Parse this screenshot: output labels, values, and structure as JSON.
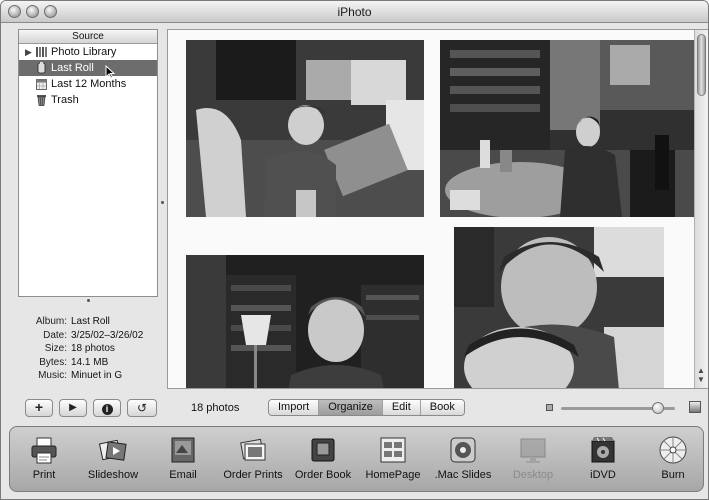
{
  "window": {
    "title": "iPhoto"
  },
  "source": {
    "header": "Source",
    "items": [
      {
        "label": "Photo Library",
        "icon": "library-icon",
        "disclosure": true
      },
      {
        "label": "Last Roll",
        "icon": "film-roll-icon",
        "selected": true
      },
      {
        "label": "Last 12 Months",
        "icon": "calendar-icon"
      },
      {
        "label": "Trash",
        "icon": "trash-icon"
      }
    ]
  },
  "info": {
    "album_label": "Album:",
    "album": "Last Roll",
    "date_label": "Date:",
    "date": "3/25/02–3/26/02",
    "size_label": "Size:",
    "size": "18 photos",
    "bytes_label": "Bytes:",
    "bytes": "14.1 MB",
    "music_label": "Music:",
    "music": "Minuet in G"
  },
  "controls": {
    "add_symbol": "+",
    "play_symbol": "▶",
    "info_symbol": "i",
    "rotate_symbol": "↺",
    "photo_count": "18 photos",
    "modes": [
      "Import",
      "Organize",
      "Edit",
      "Book"
    ],
    "active_mode": "Organize",
    "zoom_level": 0.85
  },
  "tools": [
    {
      "label": "Print",
      "icon": "printer-icon",
      "enabled": true
    },
    {
      "label": "Slideshow",
      "icon": "slideshow-icon",
      "enabled": true
    },
    {
      "label": "Email",
      "icon": "email-icon",
      "enabled": true
    },
    {
      "label": "Order Prints",
      "icon": "order-prints-icon",
      "enabled": true
    },
    {
      "label": "Order Book",
      "icon": "order-book-icon",
      "enabled": true
    },
    {
      "label": "HomePage",
      "icon": "homepage-icon",
      "enabled": true
    },
    {
      "label": ".Mac Slides",
      "icon": "mac-slides-icon",
      "enabled": true
    },
    {
      "label": "Desktop",
      "icon": "desktop-icon",
      "enabled": false
    },
    {
      "label": "iDVD",
      "icon": "idvd-icon",
      "enabled": true
    },
    {
      "label": "Burn",
      "icon": "burn-icon",
      "enabled": true
    }
  ],
  "colors": {
    "selection": "#6d6d6d",
    "toolbar": "#bdbdbd"
  }
}
